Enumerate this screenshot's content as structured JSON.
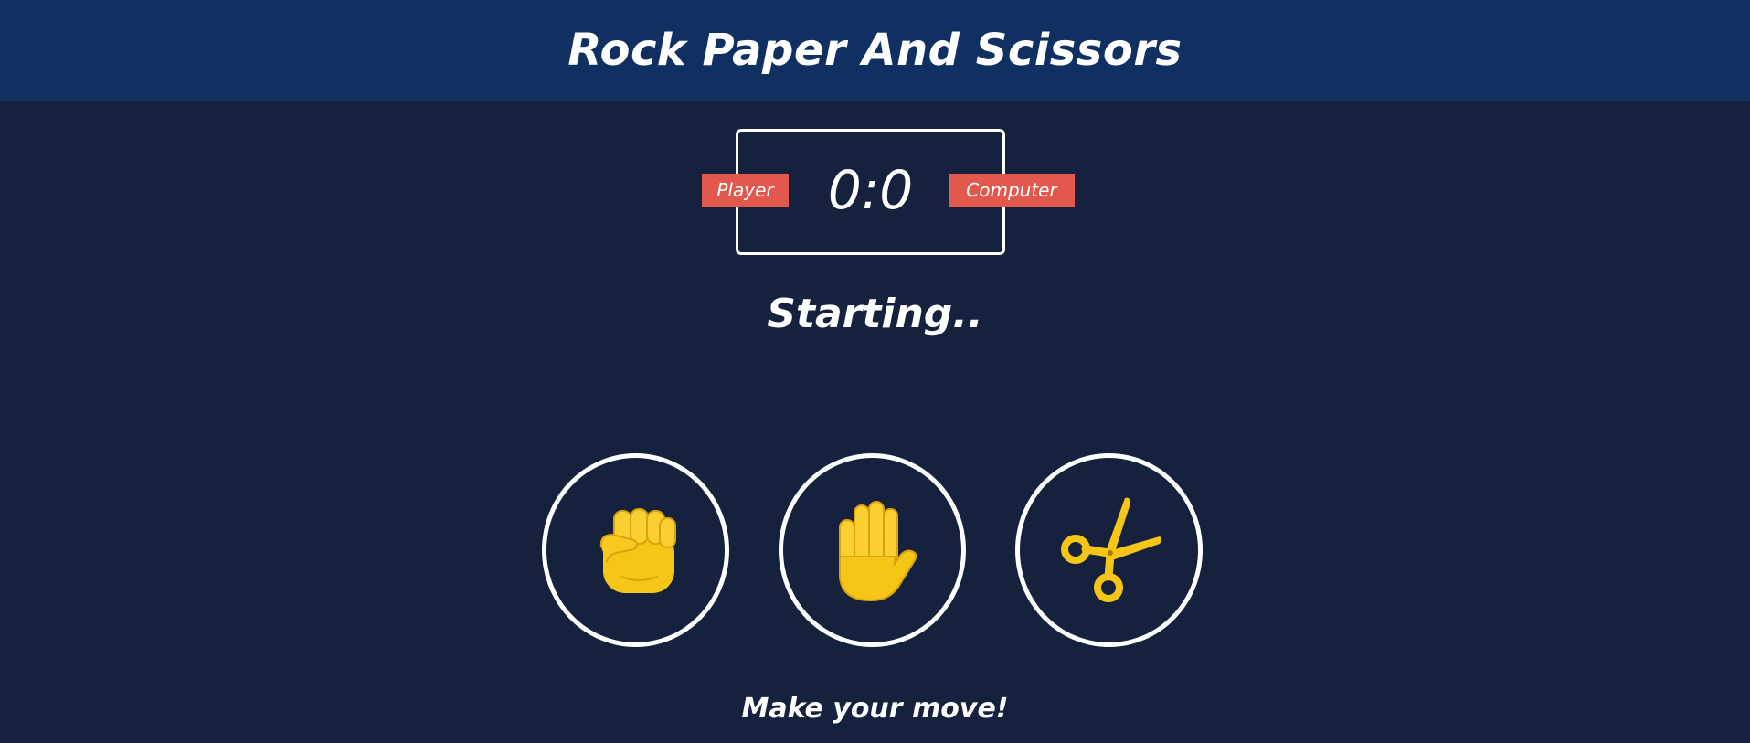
{
  "header": {
    "title": "Rock Paper And Scissors"
  },
  "scoreboard": {
    "score": "0:0",
    "player_label": "Player",
    "computer_label": "Computer"
  },
  "status": {
    "text": "Starting.."
  },
  "choices": [
    {
      "name": "rock",
      "icon": "fist-icon"
    },
    {
      "name": "paper",
      "icon": "raised-hand-icon"
    },
    {
      "name": "scissors",
      "icon": "scissors-icon"
    }
  ],
  "prompt": {
    "text": "Make your move!"
  },
  "colors": {
    "background": "#16213e",
    "header": "#0f3060",
    "badge": "#e2584d",
    "emoji_yellow": "#f5c518",
    "border": "#ffffff"
  }
}
